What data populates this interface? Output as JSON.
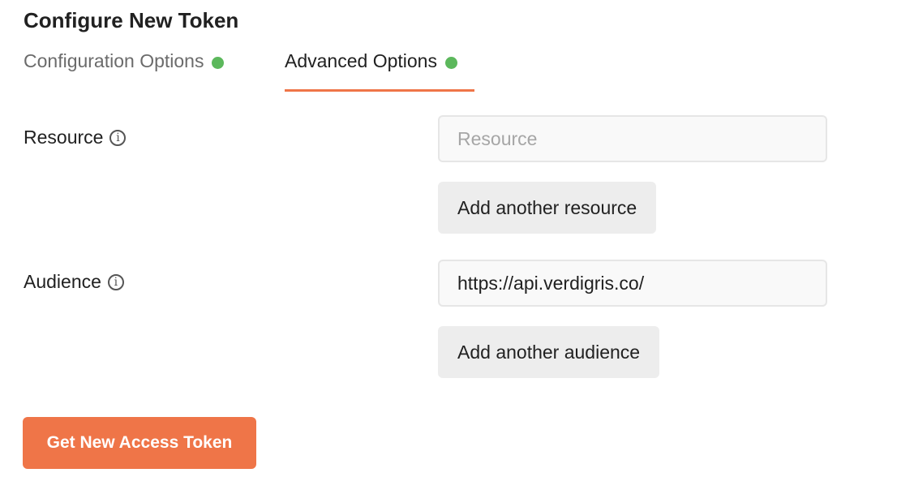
{
  "title": "Configure New Token",
  "tabs": [
    {
      "label": "Configuration Options",
      "active": false
    },
    {
      "label": "Advanced Options",
      "active": true
    }
  ],
  "resource": {
    "label": "Resource",
    "placeholder": "Resource",
    "value": "",
    "add_label": "Add another resource"
  },
  "audience": {
    "label": "Audience",
    "placeholder": "",
    "value": "https://api.verdigris.co/",
    "add_label": "Add another audience"
  },
  "info_glyph": "i",
  "submit_label": "Get New Access Token",
  "colors": {
    "accent": "#ef7548",
    "status_dot": "#5cb85c"
  }
}
